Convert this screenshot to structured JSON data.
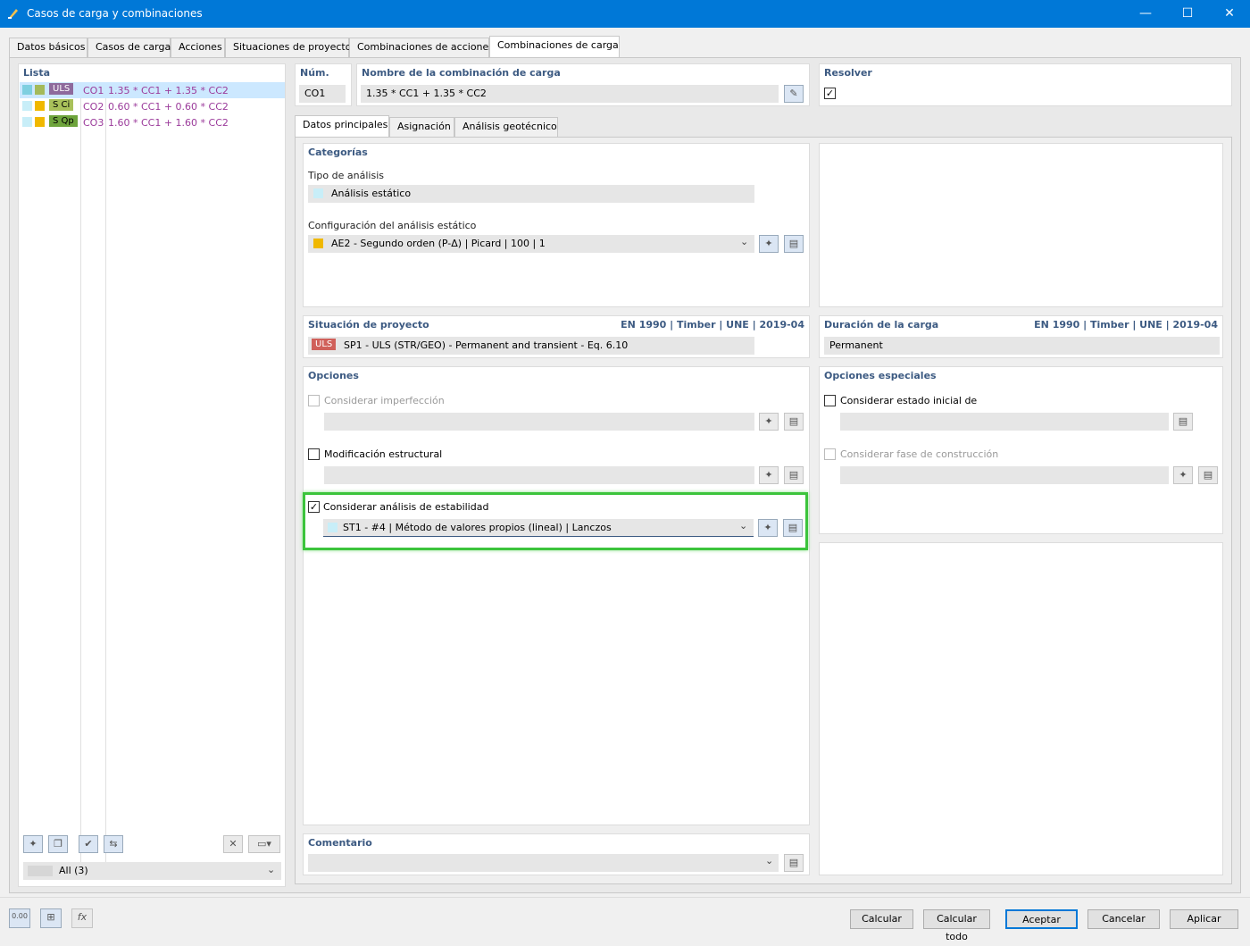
{
  "window": {
    "title": "Casos de carga y combinaciones",
    "min": "—",
    "max": "☐",
    "close": "✕"
  },
  "tabs": [
    "Datos básicos",
    "Casos de carga",
    "Acciones",
    "Situaciones de proyecto",
    "Combinaciones de acciones",
    "Combinaciones de carga"
  ],
  "list": {
    "header": "Lista",
    "items": [
      {
        "badge": "ULS",
        "badge_color": "#8e6a9c",
        "square": "#a4ba5a",
        "id": "CO1",
        "formula": "1.35 * CC1 + 1.35 * CC2"
      },
      {
        "badge": "S Ci",
        "badge_color": "#a9c15a",
        "square": "#f0b800",
        "id": "CO2",
        "formula": "0.60 * CC1 + 0.60 * CC2"
      },
      {
        "badge": "S Qp",
        "badge_color": "#6ea43c",
        "square": "#f0b800",
        "id": "CO3",
        "formula": "1.60 * CC1 + 1.60 * CC2"
      }
    ],
    "filter": "All (3)"
  },
  "num": {
    "label": "Núm.",
    "value": "CO1"
  },
  "name": {
    "label": "Nombre de la combinación de carga",
    "value": "1.35 * CC1 + 1.35 * CC2"
  },
  "resolver": {
    "label": "Resolver",
    "checked": "✓"
  },
  "subtabs": [
    "Datos principales",
    "Asignación",
    "Análisis geotécnico"
  ],
  "categorias": {
    "header": "Categorías",
    "tipo_label": "Tipo de análisis",
    "tipo_value": "Análisis estático",
    "config_label": "Configuración del análisis estático",
    "config_value": "AE2 - Segundo orden (P-Δ) | Picard | 100 | 1"
  },
  "situacion": {
    "header": "Situación de proyecto",
    "norm": "EN 1990 | Timber | UNE | 2019-04",
    "badge": "ULS",
    "value": "SP1 - ULS (STR/GEO) - Permanent and transient - Eq. 6.10"
  },
  "duracion": {
    "header": "Duración de la carga",
    "norm": "EN 1990 | Timber | UNE | 2019-04",
    "value": "Permanent"
  },
  "opciones": {
    "header": "Opciones",
    "imperfeccion": "Considerar imperfección",
    "modificacion": "Modificación estructural",
    "estabilidad": "Considerar análisis de estabilidad",
    "estabilidad_checked": "✓",
    "estabilidad_value": "ST1 - #4 | Método de valores propios (lineal) | Lanczos"
  },
  "especiales": {
    "header": "Opciones especiales",
    "estado": "Considerar estado inicial de",
    "fase": "Considerar fase de construcción"
  },
  "comentario": {
    "header": "Comentario"
  },
  "bottom_icons": {
    "value_icon": "0.00"
  },
  "buttons": {
    "calcular": "Calcular",
    "calcular_todo": "Calcular todo",
    "aceptar": "Aceptar",
    "cancelar": "Cancelar",
    "aplicar": "Aplicar"
  },
  "colors": {
    "title_bar": "#0078d7",
    "highlight": "#3cc43c",
    "text_purple": "#9b3b9b",
    "label_blue": "#3c5a82",
    "uls_red": "#d0605a",
    "cyan": "#c8eef8",
    "yellow": "#f0b800"
  }
}
